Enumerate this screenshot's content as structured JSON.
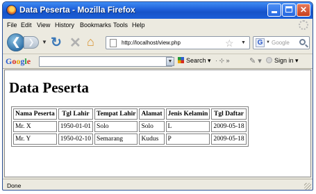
{
  "window": {
    "title": "Data Peserta - Mozilla Firefox"
  },
  "menu": [
    "File",
    "Edit",
    "View",
    "History",
    "Bookmarks",
    "Tools",
    "Help"
  ],
  "nav": {
    "url": "http://localhost/view.php",
    "search_placeholder": "Google"
  },
  "googlebar": {
    "logo": "Google",
    "search_label": "Search",
    "extras": "· ⊹ »",
    "signin_label": "Sign in"
  },
  "page": {
    "heading": "Data Peserta",
    "table": {
      "headers": [
        "Nama Peserta",
        "Tgl Lahir",
        "Tempat Lahir",
        "Alamat",
        "Jenis Kelamin",
        "Tgl Daftar"
      ],
      "rows": [
        [
          "Mr. X",
          "1950-01-01",
          "Solo",
          "Solo",
          "L",
          "2009-05-18"
        ],
        [
          "Mr. Y",
          "1950-02-10",
          "Semarang",
          "Kudus",
          "P",
          "2009-05-18"
        ]
      ]
    }
  },
  "status": {
    "text": "Done"
  },
  "icons": {
    "app": "firefox-logo-icon",
    "back": "back-arrow-icon",
    "forward": "forward-arrow-icon",
    "reload": "reload-icon",
    "stop": "stop-icon",
    "home": "home-icon",
    "bookmark": "star-icon",
    "search": "magnifier-icon"
  }
}
